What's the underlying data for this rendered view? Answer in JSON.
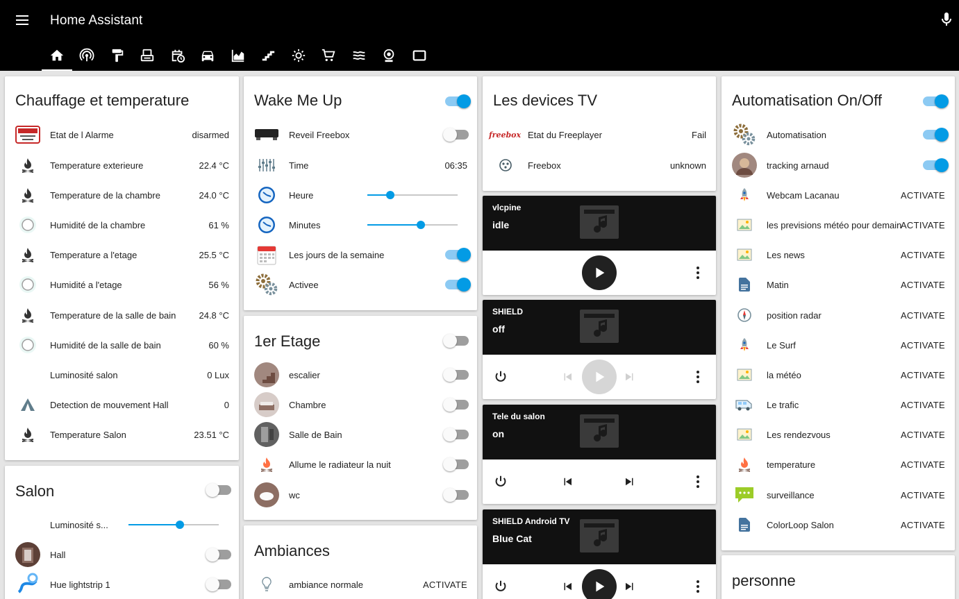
{
  "app": {
    "title": "Home Assistant"
  },
  "tabs": [
    "home-icon",
    "radar-icon",
    "paint-roller-icon",
    "printer-icon",
    "calendar-clock-icon",
    "car-icon",
    "chart-area-icon",
    "stairs-icon",
    "weather-icon",
    "cart-icon",
    "waves-icon",
    "webcam-icon",
    "tablet-icon"
  ],
  "chauffage": {
    "title": "Chauffage et temperature",
    "rows": [
      {
        "label": "Etat de l Alarme",
        "value": "disarmed"
      },
      {
        "label": "Temperature exterieure",
        "value": "22.4 °C"
      },
      {
        "label": "Temperature de la chambre",
        "value": "24.0 °C"
      },
      {
        "label": "Humidité de la chambre",
        "value": "61 %"
      },
      {
        "label": "Temperature a l'etage",
        "value": "25.5 °C"
      },
      {
        "label": "Humidité a l'etage",
        "value": "56 %"
      },
      {
        "label": "Temperature de la salle de bain",
        "value": "24.8 °C"
      },
      {
        "label": "Humidité de la salle de bain",
        "value": "60 %"
      },
      {
        "label": "Luminosité salon",
        "value": "0 Lux"
      },
      {
        "label": "Detection de mouvement Hall",
        "value": "0"
      },
      {
        "label": "Temperature Salon",
        "value": "23.51 °C"
      }
    ]
  },
  "salon": {
    "title": "Salon",
    "rows": [
      {
        "label": "Luminosité s...",
        "slider": 0.57
      },
      {
        "label": "Hall"
      },
      {
        "label": "Hue lightstrip 1"
      }
    ]
  },
  "wake": {
    "title": "Wake Me Up",
    "rows": [
      {
        "label": "Reveil Freebox"
      },
      {
        "label": "Time",
        "value": "06:35"
      },
      {
        "label": "Heure",
        "slider": 0.25
      },
      {
        "label": "Minutes",
        "slider": 0.59
      },
      {
        "label": "Les jours de la semaine"
      },
      {
        "label": "Activee"
      }
    ]
  },
  "etage": {
    "title": "1er Etage",
    "rows": [
      {
        "label": "escalier"
      },
      {
        "label": "Chambre"
      },
      {
        "label": "Salle de Bain"
      },
      {
        "label": "Allume le radiateur la nuit"
      },
      {
        "label": "wc"
      }
    ]
  },
  "ambiances": {
    "title": "Ambiances",
    "rows": [
      {
        "label": "ambiance normale",
        "action": "ACTIVATE"
      }
    ]
  },
  "tv": {
    "title": "Les devices TV",
    "rows": [
      {
        "label": "Etat du Freeplayer",
        "value": "Fail",
        "logo": "freebox"
      },
      {
        "label": "Freebox",
        "value": "unknown"
      }
    ]
  },
  "media": [
    {
      "name": "vlcpine",
      "state": "idle"
    },
    {
      "name": "SHIELD",
      "state": "off"
    },
    {
      "name": "Tele du salon",
      "state": "on"
    },
    {
      "name": "SHIELD Android TV",
      "state": "Blue Cat"
    }
  ],
  "auto": {
    "title": "Automatisation On/Off",
    "rows": [
      {
        "label": "Automatisation"
      },
      {
        "label": "tracking arnaud"
      },
      {
        "label": "Webcam Lacanau",
        "action": "ACTIVATE"
      },
      {
        "label": "les previsions météo pour demain",
        "action": "ACTIVATE"
      },
      {
        "label": "Les news",
        "action": "ACTIVATE"
      },
      {
        "label": "Matin",
        "action": "ACTIVATE"
      },
      {
        "label": "position radar",
        "action": "ACTIVATE"
      },
      {
        "label": "Le Surf",
        "action": "ACTIVATE"
      },
      {
        "label": "la météo",
        "action": "ACTIVATE"
      },
      {
        "label": "Le trafic",
        "action": "ACTIVATE"
      },
      {
        "label": "Les rendezvous",
        "action": "ACTIVATE"
      },
      {
        "label": "temperature",
        "action": "ACTIVATE"
      },
      {
        "label": "surveillance",
        "action": "ACTIVATE"
      },
      {
        "label": "ColorLoop Salon",
        "action": "ACTIVATE"
      }
    ]
  },
  "personne": {
    "title": "personne"
  },
  "labels": {
    "freebox_logo": "freebox"
  },
  "colors": {
    "accent": "#039be5",
    "header": "#000000",
    "background": "#e5e5e5"
  }
}
